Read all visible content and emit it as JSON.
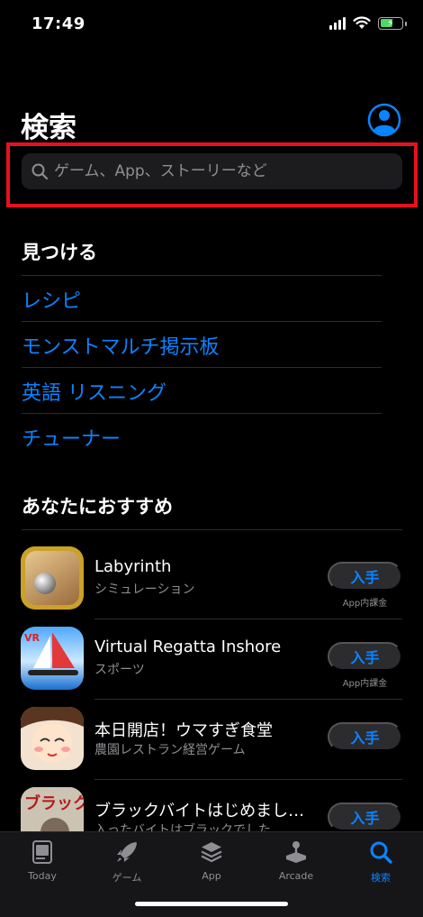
{
  "status": {
    "time": "17:49"
  },
  "page": {
    "title": "検索"
  },
  "search": {
    "placeholder": "ゲーム、App、ストーリーなど"
  },
  "discover": {
    "title": "見つける",
    "items": [
      "レシピ",
      "モンストマルチ掲示板",
      "英語 リスニング",
      "チューナー"
    ]
  },
  "recommend": {
    "title": "あなたにおすすめ",
    "apps": [
      {
        "name": "Labyrinth",
        "subtitle": "シミュレーション",
        "button": "入手",
        "iap": "App内課金"
      },
      {
        "name": "Virtual Regatta Inshore",
        "subtitle": "スポーツ",
        "button": "入手",
        "iap": "App内課金"
      },
      {
        "name": "本日開店！ウマすぎ食堂",
        "subtitle": "農園レストラン経営ゲーム",
        "button": "入手"
      },
      {
        "name": "ブラックバイトはじめまし…",
        "subtitle": "入ったバイトはブラックでした",
        "button": "入手"
      }
    ]
  },
  "tabs": [
    {
      "label": "Today",
      "icon": "today-icon"
    },
    {
      "label": "ゲーム",
      "icon": "rocket-icon"
    },
    {
      "label": "App",
      "icon": "layers-icon"
    },
    {
      "label": "Arcade",
      "icon": "joystick-icon"
    },
    {
      "label": "検索",
      "icon": "search-icon",
      "active": true
    }
  ],
  "colors": {
    "accent": "#0a84ff",
    "highlight": "#e8101f",
    "background": "#000000"
  }
}
